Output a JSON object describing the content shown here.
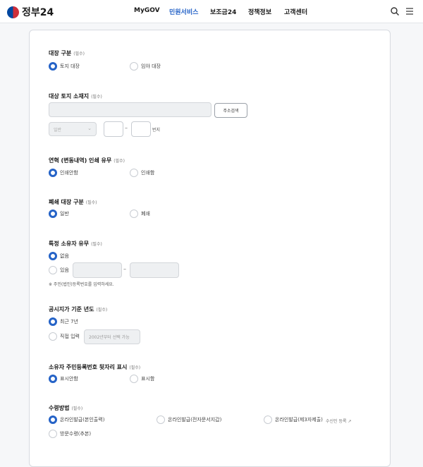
{
  "header": {
    "logo_text": "정부24",
    "nav": [
      "MyGOV",
      "민원서비스",
      "보조금24",
      "정책정보",
      "고객센터"
    ]
  },
  "required_label": "(필수)",
  "sections": {
    "ledger_type": {
      "title": "대장 구분",
      "options": [
        "토지 대장",
        "임야 대장"
      ]
    },
    "location": {
      "title": "대상 토지 소재지",
      "search_button": "주소검색",
      "select_value": "일반",
      "unit": "번지"
    },
    "history": {
      "title": "연혁 (변동내역) 인쇄 유무",
      "options": [
        "인쇄안함",
        "인쇄함"
      ]
    },
    "closed": {
      "title": "폐쇄 대장 구분",
      "options": [
        "일반",
        "폐쇄"
      ]
    },
    "owner": {
      "title": "특정 소유자 유무",
      "options": [
        "없음",
        "있음"
      ],
      "note": "※ 주민(법인)등록번호를 입력하세요."
    },
    "price_year": {
      "title": "공시지가 기준 년도",
      "options": [
        "최근 7년",
        "직접 입력"
      ],
      "year_placeholder": "2002년부터 선택 가능"
    },
    "rrn_display": {
      "title": "소유자 주민등록번호 뒷자리 표시",
      "options": [
        "표시안함",
        "표시함"
      ]
    },
    "receipt": {
      "title": "수령방법",
      "options": [
        "온라인발급(본인출력)",
        "온라인발급(전자문서지갑)",
        "온라인발급(제3자제출)",
        "방문수령(추본)"
      ],
      "extra": "수신인 등록"
    }
  },
  "colors": {
    "accent": "#2563c7"
  }
}
